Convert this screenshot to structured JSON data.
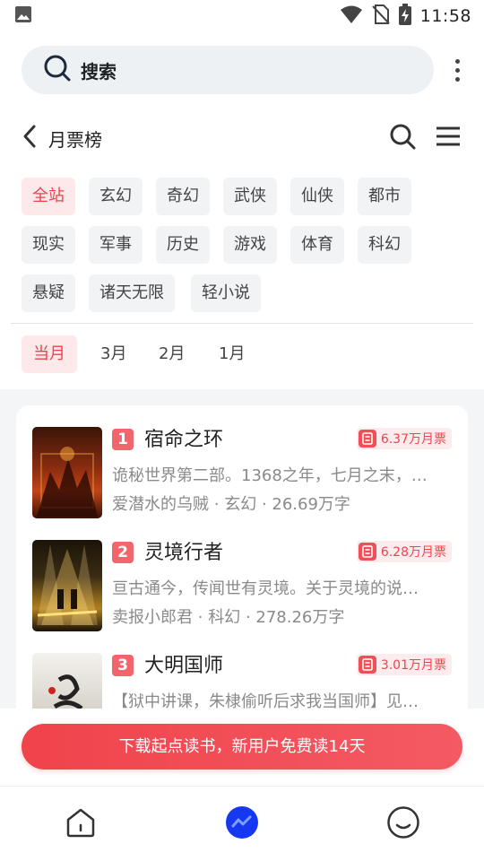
{
  "status_bar": {
    "time": "11:58"
  },
  "search": {
    "label": "搜索"
  },
  "header": {
    "title": "月票榜"
  },
  "categories": [
    "全站",
    "玄幻",
    "奇幻",
    "武侠",
    "仙侠",
    "都市",
    "现实",
    "军事",
    "历史",
    "游戏",
    "体育",
    "科幻",
    "悬疑",
    "诸天无限",
    "轻小说"
  ],
  "periods": [
    "当月",
    "3月",
    "2月",
    "1月"
  ],
  "books": [
    {
      "rank": "1",
      "title": "宿命之环",
      "votes": "6.37万月票",
      "desc": "诡秘世界第二部。1368之年，七月之末，…",
      "author": "爱潜水的乌贼",
      "genre": "玄幻",
      "words": "26.69万字"
    },
    {
      "rank": "2",
      "title": "灵境行者",
      "votes": "6.28万月票",
      "desc": "亘古通今，传闻世有灵境。关于灵境的说…",
      "author": "卖报小郎君",
      "genre": "科幻",
      "words": "278.26万字"
    },
    {
      "rank": "3",
      "title": "大明国师",
      "votes": "3.01万月票",
      "desc": "【狱中讲课，朱棣偷听后求我当国师】见…",
      "author": "",
      "genre": "",
      "words": ""
    }
  ],
  "meta_sep": "·",
  "cta": {
    "label": "下载起点读书，新用户免费读14天"
  },
  "colors": {
    "accent": "#ed424b",
    "chip_bg": "#f2f3f5",
    "active_chip_bg": "#fde9ea",
    "nav_active": "#1638f0"
  }
}
